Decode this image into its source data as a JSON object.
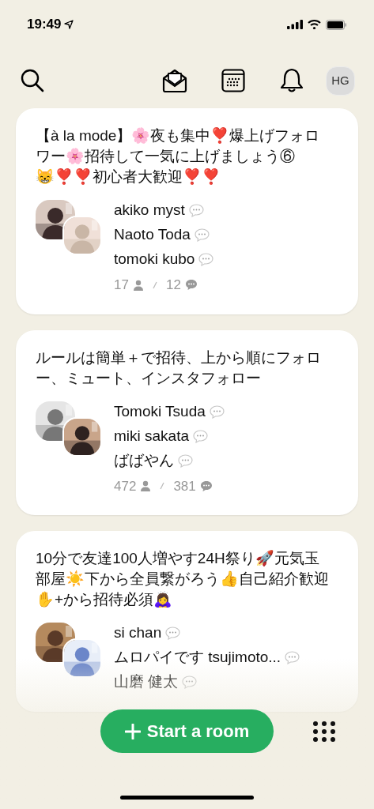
{
  "status_bar": {
    "time": "19:49"
  },
  "toolbar": {
    "avatar_initials": "HG"
  },
  "rooms": [
    {
      "title": "【à la mode】🌸夜も集中❣️爆上げフォロワー🌸招待して一気に上げましょう⑥😸❣️❣️初心者大歓迎❣️❣️",
      "speakers": [
        "akiko myst",
        "Naoto Toda",
        "tomoki kubo"
      ],
      "listeners": "17",
      "speakers_count": "12"
    },
    {
      "title": "ルールは簡単＋で招待、上から順にフォロー、ミュート、インスタフォロー",
      "speakers": [
        "Tomoki Tsuda",
        "miki sakata",
        "ばばやん"
      ],
      "listeners": "472",
      "speakers_count": "381"
    },
    {
      "title": "10分で友達100人増やす24H祭り🚀元気玉部屋☀️下から全員繋がろう👍自己紹介歓迎✋+から招待必須🙇‍♀️",
      "speakers": [
        "si chan",
        "ムロパイです tsujimoto...",
        "山磨 健太"
      ]
    }
  ],
  "start_button": {
    "label": "Start a room"
  }
}
